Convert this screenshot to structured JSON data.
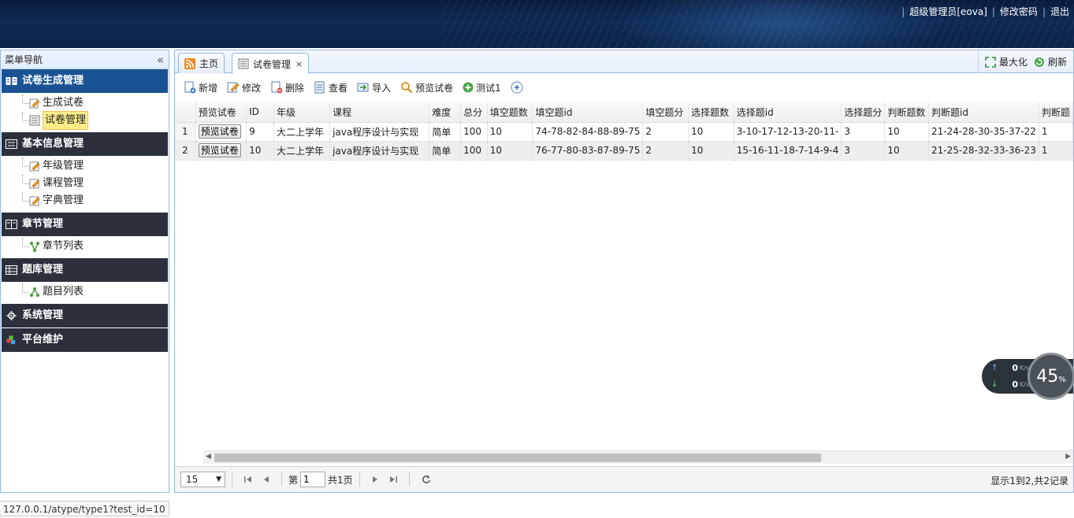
{
  "header": {
    "user_link": "超级管理员[eova]",
    "change_password": "修改密码",
    "logout": "退出"
  },
  "sidebar": {
    "title": "菜单导航",
    "groups": [
      {
        "label": "试卷生成管理",
        "items": [
          "生成试卷",
          "试卷管理"
        ]
      },
      {
        "label": "基本信息管理",
        "items": [
          "年级管理",
          "课程管理",
          "字典管理"
        ]
      },
      {
        "label": "章节管理",
        "items": [
          "章节列表"
        ]
      },
      {
        "label": "题库管理",
        "items": [
          "题目列表"
        ]
      },
      {
        "label": "系统管理",
        "items": []
      },
      {
        "label": "平台维护",
        "items": []
      }
    ]
  },
  "tabs": {
    "home": "主页",
    "current": "试卷管理",
    "close": "×",
    "maximize": "最大化",
    "refresh": "刷新"
  },
  "toolbar": {
    "add": "新增",
    "edit": "修改",
    "delete": "删除",
    "view": "查看",
    "import": "导入",
    "preview": "预览试卷",
    "test1": "测试1"
  },
  "table": {
    "columns": [
      "预览试卷",
      "ID",
      "年级",
      "课程",
      "难度",
      "总分",
      "填空题数",
      "填空题id",
      "填空题分",
      "选择题数",
      "选择题id",
      "选择题分",
      "判断题数",
      "判断题id",
      "判断题"
    ],
    "rows": [
      {
        "rn": "1",
        "btn": "预览试卷",
        "cells": [
          "9",
          "大二上学年",
          "java程序设计与实现",
          "简单",
          "100",
          "10",
          "74-78-82-84-88-89-75",
          "2",
          "10",
          "3-10-17-12-13-20-11-",
          "3",
          "10",
          "21-24-28-30-35-37-22",
          "1"
        ]
      },
      {
        "rn": "2",
        "btn": "预览试卷",
        "cells": [
          "10",
          "大二上学年",
          "java程序设计与实现",
          "简单",
          "100",
          "10",
          "76-77-80-83-87-89-75",
          "2",
          "10",
          "15-16-11-18-7-14-9-4",
          "3",
          "10",
          "21-25-28-32-33-36-23",
          "1"
        ]
      }
    ]
  },
  "pager": {
    "page_size": "15",
    "page_prefix": "第",
    "page_value": "1",
    "page_total": "共1页",
    "info": "显示1到2,共2记录"
  },
  "statusbar": {
    "url": "127.0.0.1/atype/type1?test_id=10"
  },
  "speed_widget": {
    "up": "0",
    "down": "0",
    "unit": "K/s",
    "percent": "45",
    "percent_sign": "%"
  }
}
